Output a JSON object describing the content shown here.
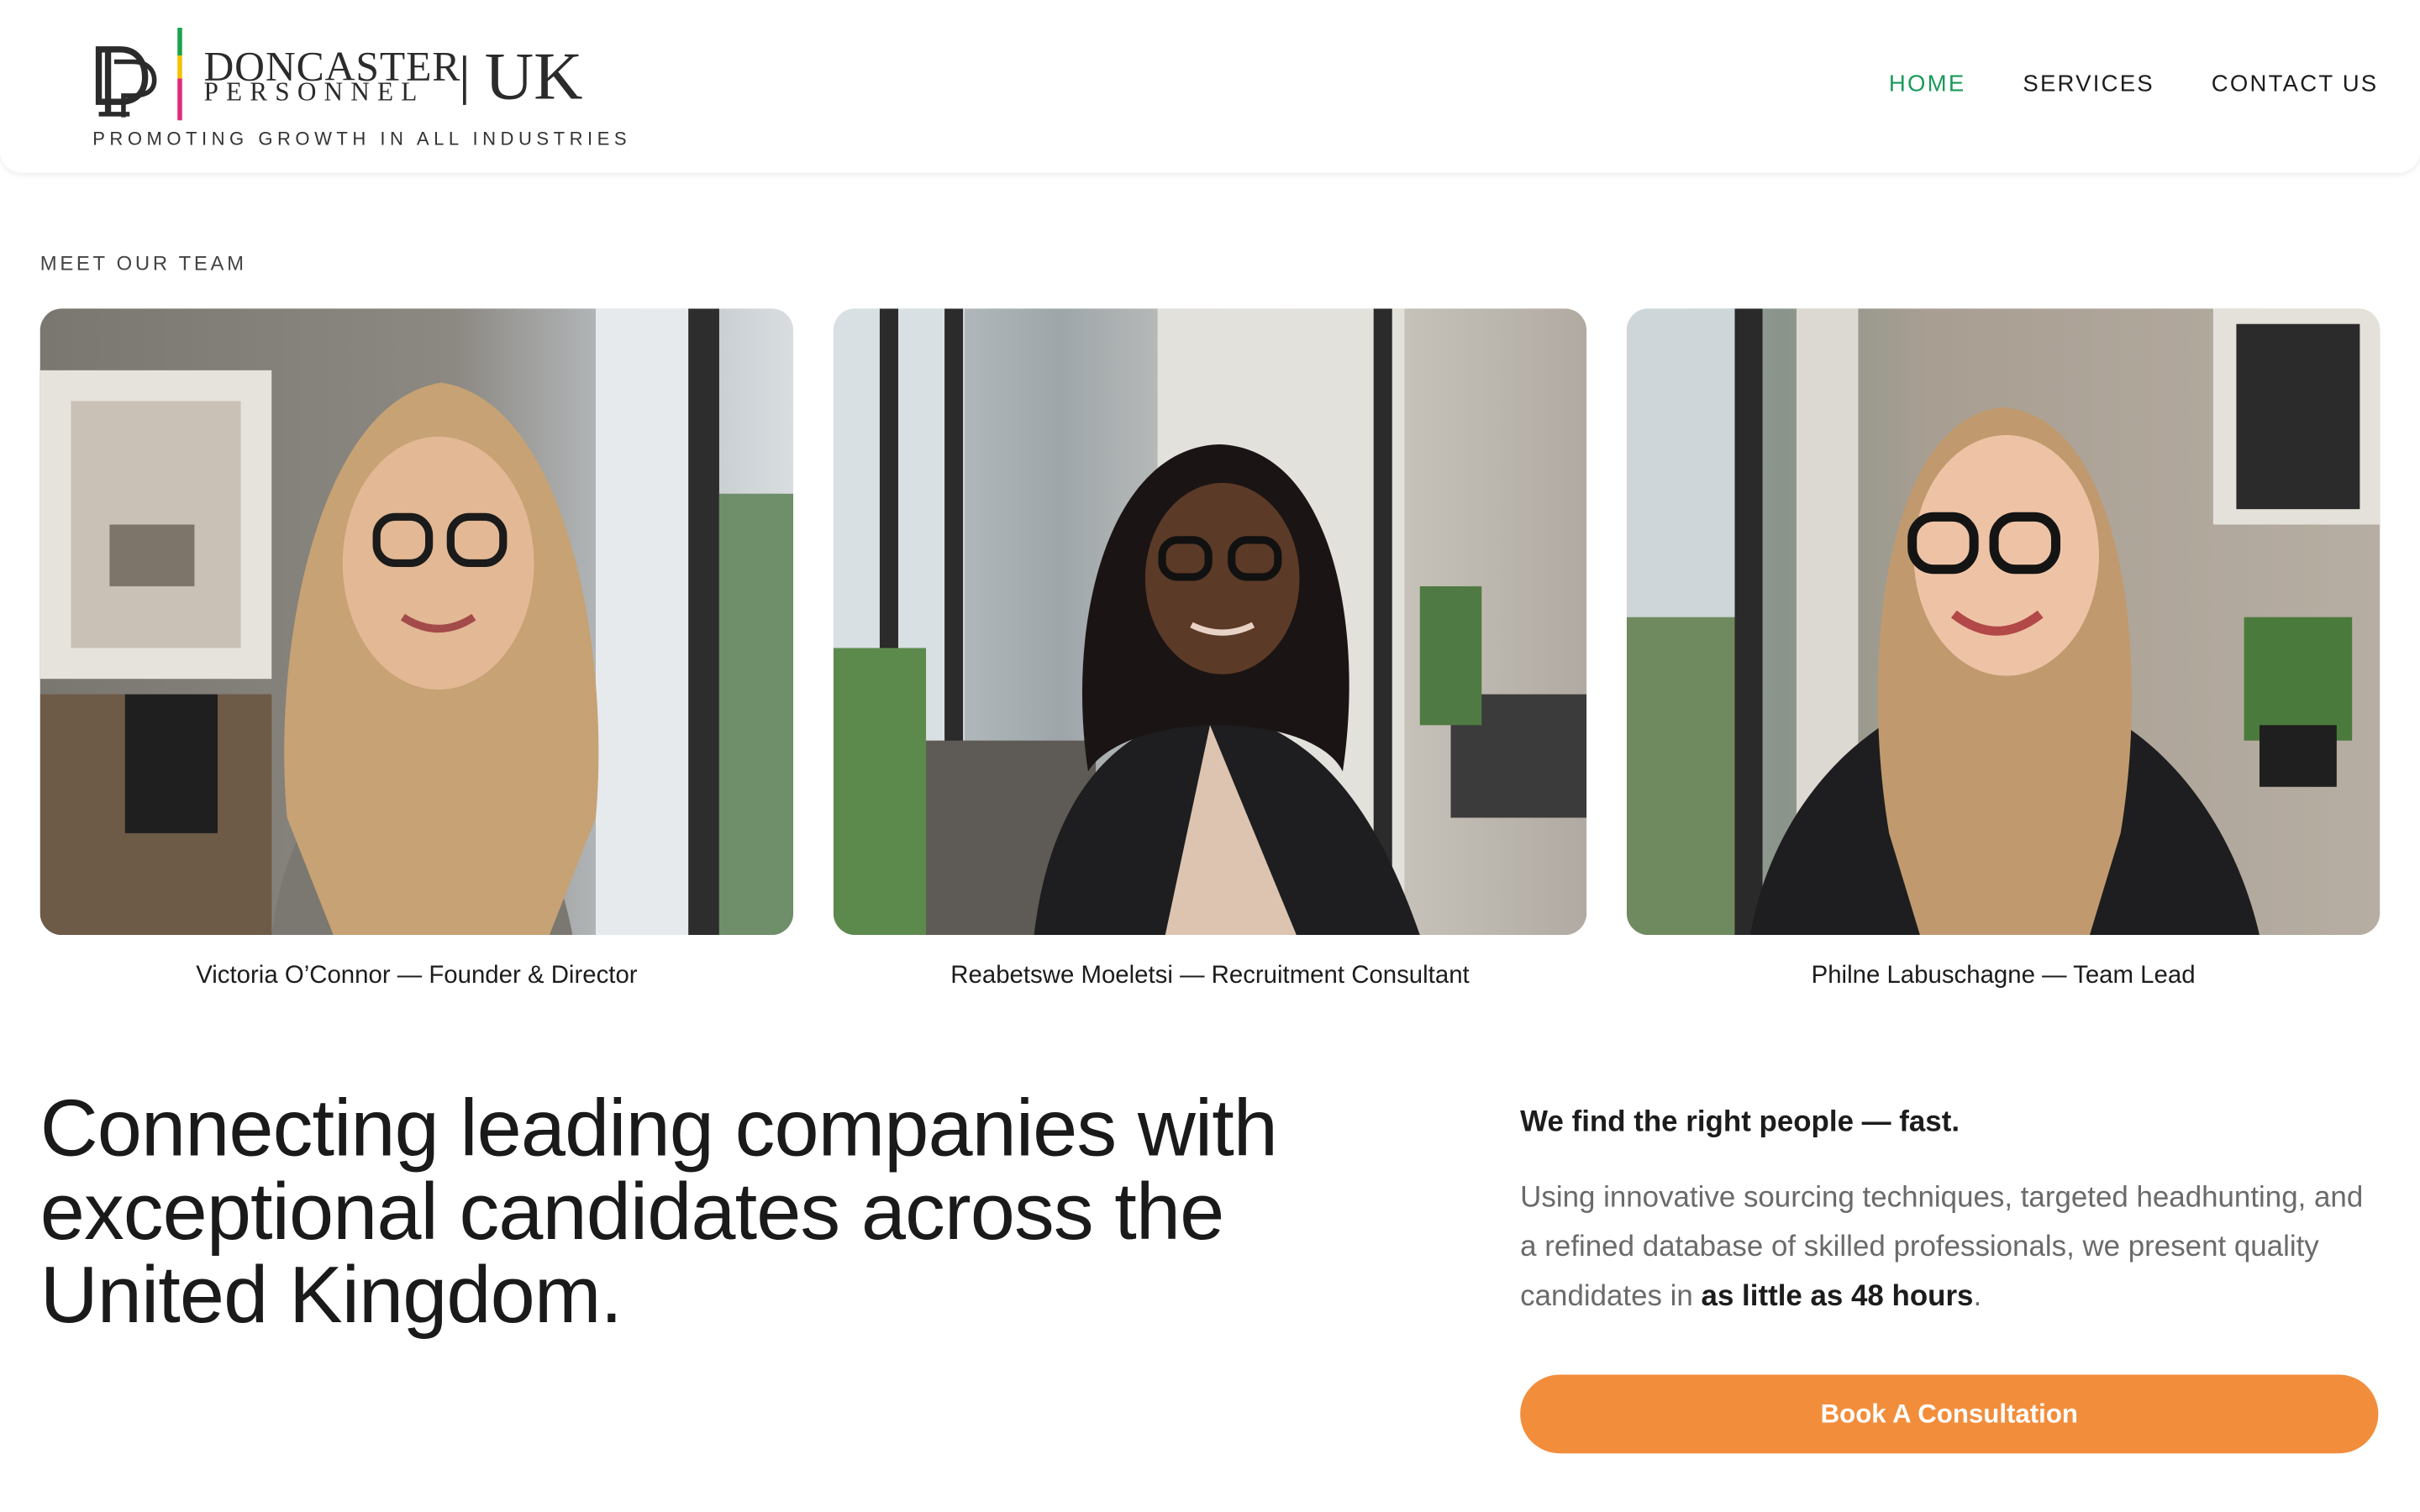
{
  "brand": {
    "name_line1": "DONCASTER",
    "name_line2": "PERSONNEL",
    "region": "UK",
    "tagline": "PROMOTING GROWTH IN ALL INDUSTRIES",
    "mark_letters": "DP",
    "colors": {
      "green": "#1aa34a",
      "yellow": "#f2c200",
      "pink": "#e22a7d"
    }
  },
  "nav": {
    "items": [
      {
        "label": "HOME",
        "active": true
      },
      {
        "label": "SERVICES",
        "active": false
      },
      {
        "label": "CONTACT US",
        "active": false
      }
    ],
    "active_color": "#1a9a5a"
  },
  "team": {
    "eyebrow": "MEET OUR TEAM",
    "members": [
      {
        "caption": "Victoria O’Connor — Founder & Director"
      },
      {
        "caption": "Reabetswe Moeletsi — Recruitment Consultant"
      },
      {
        "caption": "Philne Labuschagne — Team Lead"
      }
    ]
  },
  "hero": {
    "headline": "Connecting leading companies with exceptional candidates across the United Kingdom.",
    "lead": "We find the right people — fast.",
    "body_prefix": "Using innovative sourcing techniques, targeted headhunting, and a refined database of skilled professionals, we present quality candidates in ",
    "body_bold": "as little as 48 hours",
    "body_suffix": ".",
    "cta_label": "Book A Consultation",
    "cta_color": "#f28d3c"
  }
}
